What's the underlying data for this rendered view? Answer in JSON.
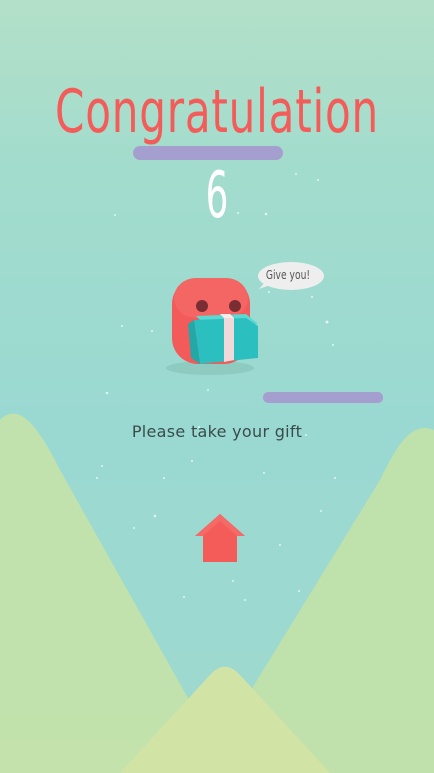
{
  "screen": {
    "title": "Congratulation",
    "score": "6",
    "speech_bubble": "Give you!",
    "message": "Please take your gift",
    "home_button": {
      "icon": "home-icon"
    }
  },
  "colors": {
    "title": "#f45c59",
    "score": "#ffffff",
    "bar": "#a49fcf",
    "character": "#f45c59",
    "gift_box": "#2cbfbf",
    "gift_ribbon": "#f2d9d9",
    "home_button": "#f45c59",
    "hill": "#cfe3a6"
  }
}
